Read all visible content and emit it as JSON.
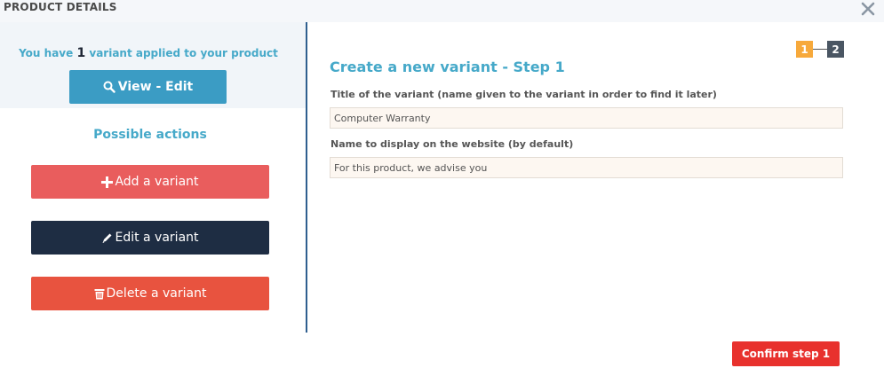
{
  "header": {
    "title": "PRODUCT DETAILS",
    "close_icon": "close-icon"
  },
  "sidebar": {
    "variant_count_prefix": "You have ",
    "variant_count": "1",
    "variant_count_suffix": " variant applied to your product",
    "view_edit_label": "View - Edit",
    "view_edit_icon": "search-icon",
    "possible_actions_label": "Possible actions",
    "actions": [
      {
        "label": "Add a variant",
        "icon": "plus-icon",
        "color": "#e95d5d"
      },
      {
        "label": "Edit a variant",
        "icon": "pencil-icon",
        "color": "#1e2d43"
      },
      {
        "label": "Delete a variant",
        "icon": "trash-icon",
        "color": "#e8533f"
      }
    ]
  },
  "main": {
    "title": "Create a new variant - Step 1",
    "steps": [
      "1",
      "2"
    ],
    "fields": [
      {
        "label": "Title of the variant (name given to the variant in order to find it later)",
        "value": "Computer Warranty"
      },
      {
        "label": "Name to display on the website (by default)",
        "value": "For this product, we advise you"
      }
    ],
    "confirm_label": "Confirm step 1"
  },
  "colors": {
    "accent": "#46a9c9",
    "confirm": "#e8312d",
    "step_active": "#f7a93b",
    "step_inactive": "#4a5663"
  }
}
